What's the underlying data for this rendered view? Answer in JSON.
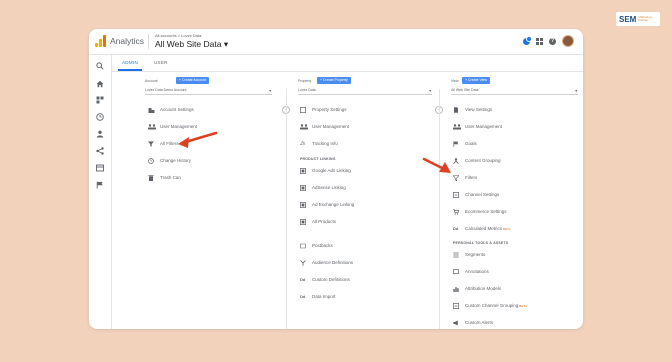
{
  "watermark": {
    "text": "SEM",
    "sub": "Marketing Partner"
  },
  "header": {
    "app_name": "Analytics",
    "breadcrumb": "All accounts > Lovex Data",
    "property_title": "All Web Site Data ▾",
    "notification_count": "1"
  },
  "tabs": [
    {
      "label": "ADMIN"
    },
    {
      "label": "USER"
    }
  ],
  "account": {
    "label": "Account",
    "create_label": "+ Create Account",
    "selected": "Lovex Data Demo Account",
    "items": [
      {
        "label": "Account Settings"
      },
      {
        "label": "User Management"
      },
      {
        "label": "All Filters"
      },
      {
        "label": "Change History"
      },
      {
        "label": "Trash Can"
      }
    ]
  },
  "property": {
    "label": "Property",
    "create_label": "+ Create Property",
    "selected": "Lovex Data",
    "items": [
      {
        "label": "Property Settings"
      },
      {
        "label": "User Management"
      },
      {
        "label": "Tracking Info"
      }
    ],
    "section_title": "PRODUCT LINKING",
    "linking_items": [
      {
        "label": "Google Ads Linking"
      },
      {
        "label": "AdSense Linking"
      },
      {
        "label": "Ad Exchange Linking"
      },
      {
        "label": "All Products"
      }
    ],
    "other_items": [
      {
        "label": "Postbacks"
      },
      {
        "label": "Audience Definitions"
      },
      {
        "label": "Custom Definitions"
      },
      {
        "label": "Data Import"
      }
    ]
  },
  "view": {
    "label": "View",
    "create_label": "+ Create View",
    "selected": "All Web Site Data",
    "items": [
      {
        "label": "View Settings"
      },
      {
        "label": "User Management"
      },
      {
        "label": "Goals"
      },
      {
        "label": "Content Grouping"
      },
      {
        "label": "Filters"
      },
      {
        "label": "Channel Settings"
      },
      {
        "label": "Ecommerce Settings"
      },
      {
        "label": "Calculated Metrics",
        "badge": "BETA"
      }
    ],
    "section_title": "PERSONAL TOOLS & ASSETS",
    "personal_items": [
      {
        "label": "Segments"
      },
      {
        "label": "Annotations"
      },
      {
        "label": "Attribution Models"
      },
      {
        "label": "Custom Channel Grouping",
        "badge": "BETA"
      },
      {
        "label": "Custom Alerts"
      }
    ]
  },
  "colors": {
    "accent": "#1a73e8",
    "button": "#4a8cf0",
    "annotation_arrow": "#e0401f",
    "background": "#f2d2bb"
  }
}
